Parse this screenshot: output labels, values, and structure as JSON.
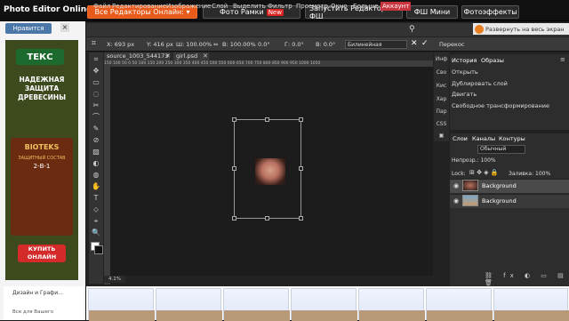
{
  "topbar": {
    "logo": "Photo Editor Online",
    "buttons": [
      {
        "label": "Все Редакторы Онлайн: ▾"
      },
      {
        "label": "Фото Рамки",
        "badge": "New"
      },
      {
        "label": "Запустить Редактор ФШ"
      },
      {
        "label": "ФШ Мини"
      },
      {
        "label": "Фотоэффекты"
      }
    ]
  },
  "left_ad": {
    "like": "Нравится",
    "close": "×",
    "brand": "ТЕКС",
    "slogan": "НАДЕЖНАЯ ЗАЩИТА ДРЕВЕСИНЫ",
    "product_name": "BIOTEKS",
    "product_sub": "ЗАЩИТНЫЙ СОСТАВ",
    "product_sub2": "2-В-1",
    "buy": "КУПИТЬ ОНЛАЙН",
    "bottom_title": "Дизайн и Графи...",
    "bottom_sub": "Все для Вашего"
  },
  "menu": {
    "items": [
      "Файл",
      "Редактирование",
      "Изображение",
      "Слой",
      "Выделить",
      "Фильтр",
      "Просмотр",
      "Окно",
      "Больше"
    ],
    "account": "Аккаунт",
    "expand": "Развернуть на весь экран"
  },
  "options": {
    "x": "X: 693 px",
    "y": "Y: 416 px",
    "w": "Ш: 100.00%",
    "h": "В: 100.00%",
    "angle": "0.0°",
    "skew_h": "Г: 0.0°",
    "skew_v": "В: 0.0°",
    "interp": "Билинейная",
    "perspective": "Перекос"
  },
  "documents": {
    "tabs": [
      "source_1003_544173",
      "girl.psd"
    ],
    "ruler": "150 100 50 0 50 100 150 200 250 300 350 400 450 500 550 600 650 700 750 800 850 900 950 1000 1050",
    "zoom": "4.1%"
  },
  "tools": [
    "⌗",
    "✥",
    "▭",
    "◌",
    "✂",
    "⌒",
    "✎",
    "⊘",
    "▨",
    "◐",
    "◍",
    "✋",
    "T",
    "⬦",
    "⌖",
    "🔍",
    "■"
  ],
  "right": {
    "mini_tabs": [
      "Инф",
      "Сво",
      "Кис",
      "Хар",
      "Пар",
      "CSS",
      "▣"
    ],
    "history_tabs": [
      "История",
      "Образы"
    ],
    "history": [
      "Открыть",
      "Дублировать слой",
      "Двигать",
      "Свободное трансформирование"
    ],
    "layer_tabs": [
      "Слои",
      "Каналы",
      "Контуры"
    ],
    "blend": "Обычный",
    "opacity": "Непрозр.: 100%",
    "lock": "Lock:",
    "fill": "Заливка: 100%",
    "layers": [
      "Background",
      "Background"
    ]
  },
  "colors": {
    "accent": "#e85a1a",
    "account": "#c8353f"
  }
}
